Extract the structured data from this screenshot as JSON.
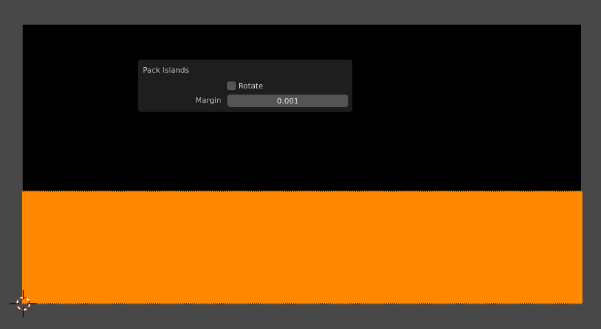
{
  "panel": {
    "title": "Pack Islands",
    "rotate": {
      "label": "Rotate",
      "checked": false
    },
    "margin": {
      "label": "Margin",
      "value": "0.001"
    }
  },
  "canvas": {
    "background_color": "#484848",
    "upper_region_color": "#000000",
    "lower_region_color": "#ff8800"
  },
  "icons": {
    "cursor": "3d-cursor-icon"
  }
}
